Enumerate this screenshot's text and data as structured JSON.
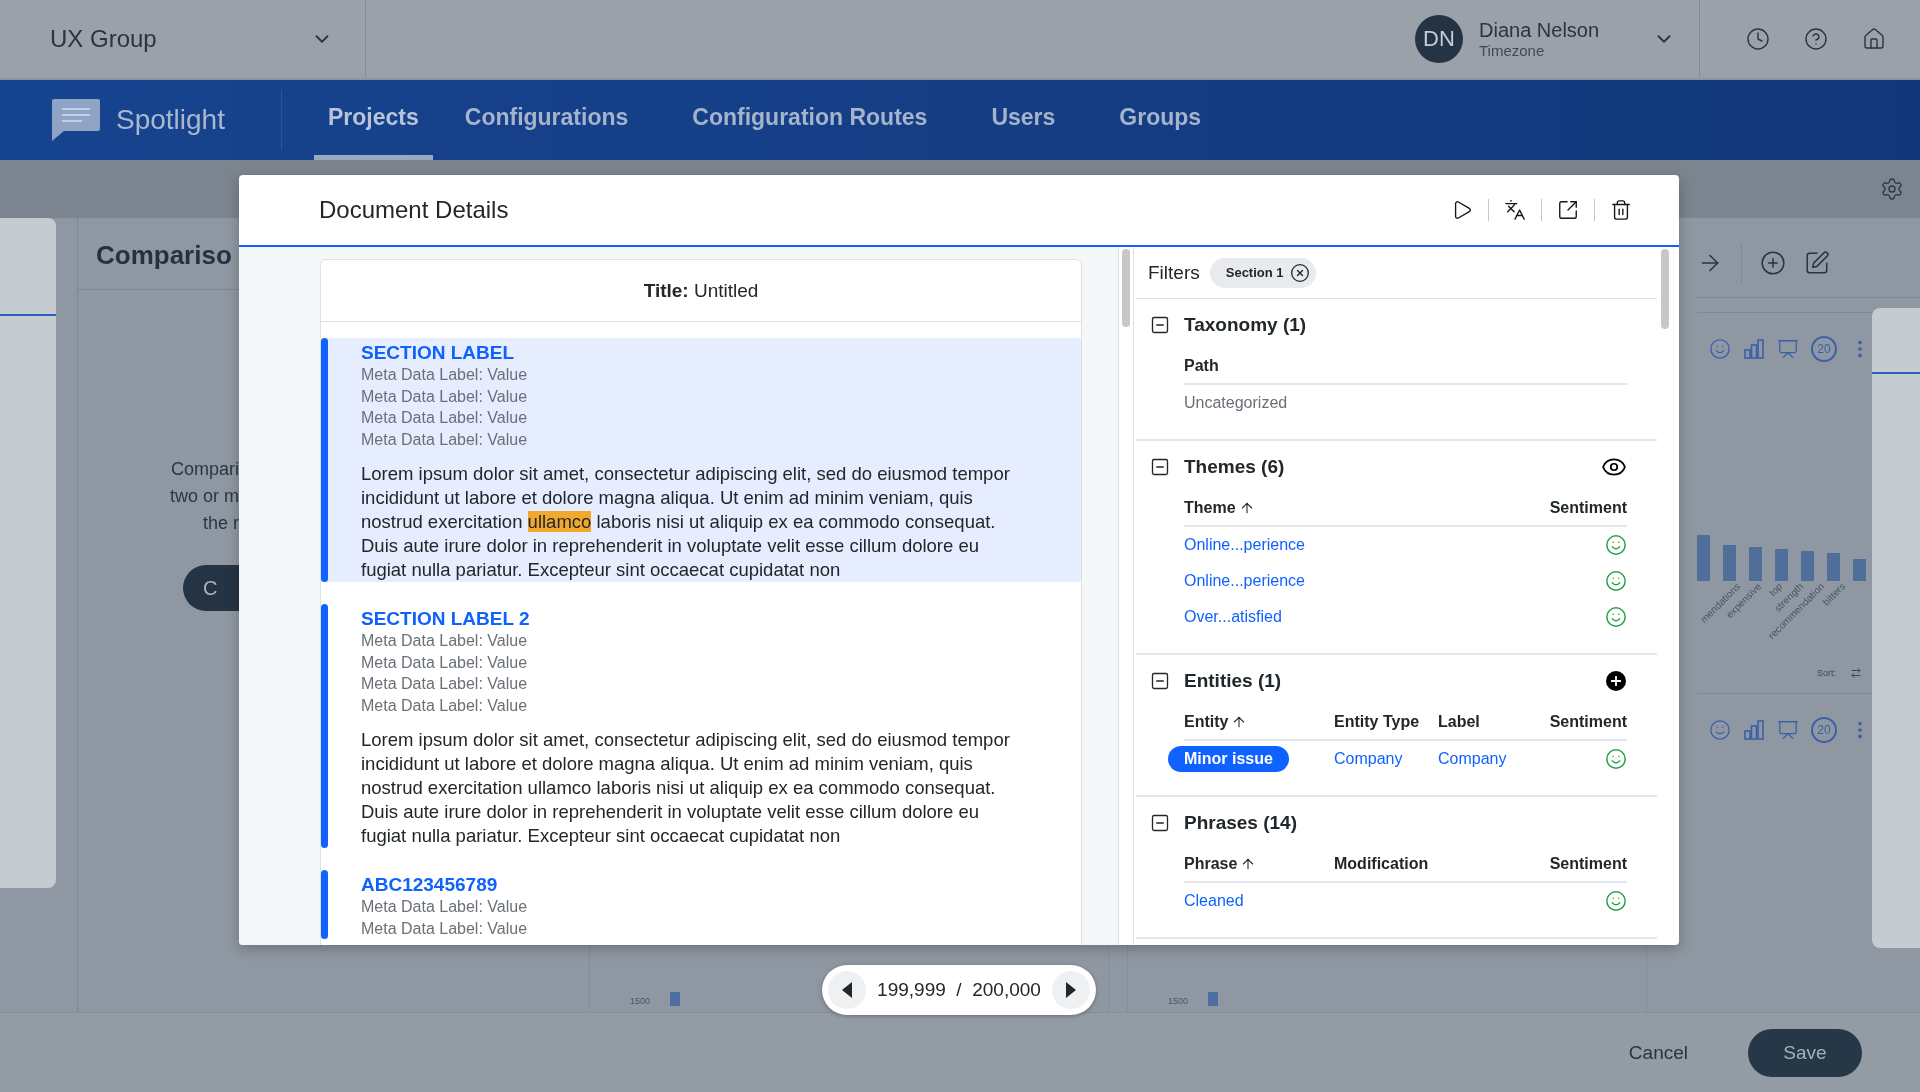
{
  "top_bar": {
    "group": "UX Group",
    "user": {
      "initials": "DN",
      "name": "Diana Nelson",
      "subtitle": "Timezone"
    }
  },
  "nav": {
    "brand": "Spotlight",
    "tabs": [
      {
        "label": "Projects",
        "selected": true
      },
      {
        "label": "Configurations",
        "selected": false
      },
      {
        "label": "Configuration Routes",
        "selected": false
      },
      {
        "label": "Users",
        "selected": false
      },
      {
        "label": "Groups",
        "selected": false
      }
    ]
  },
  "background": {
    "heading": "Compariso",
    "empty_lines": [
      "Compari",
      "two or m",
      "the r"
    ],
    "start_button": "C",
    "chart_labels": [
      "mendations",
      "expensive",
      "top",
      "strength",
      "recommendation",
      "bitters"
    ],
    "sort_label": "Sort:",
    "panels": [
      {
        "count": "20"
      },
      {
        "count": "20"
      }
    ],
    "lower_charts": [
      {
        "tick": "1500"
      },
      {
        "tick": "1500"
      }
    ]
  },
  "modal": {
    "title": "Document Details",
    "document": {
      "title": "**Title:** Untitled",
      "sections": [
        {
          "label": "SECTION LABEL",
          "selected": true,
          "meta": [
            "Meta Data Label: Value",
            "Meta Data Label: Value",
            "Meta Data Label: Value",
            "Meta Data Label: Value"
          ],
          "paragraph": [
            {
              "text": "Lorem ipsum dolor sit amet, consectetur adipiscing elit, sed do eiusmod tempor incididunt ut labore et dolore magna aliqua. Ut enim ad minim veniam, quis nostrud exercitation ",
              "highlighted": false
            },
            {
              "text": "ullamco",
              "highlighted": true
            },
            {
              "text": " laboris nisi ut aliquip ex ea commodo consequat. Duis aute irure dolor in reprehenderit in voluptate velit esse cillum dolore eu fugiat nulla pariatur. Excepteur sint occaecat cupidatat non",
              "highlighted": false
            }
          ]
        },
        {
          "label": "SECTION LABEL 2",
          "selected": false,
          "meta": [
            "Meta Data Label: Value",
            "Meta Data Label: Value",
            "Meta Data Label: Value",
            "Meta Data Label: Value"
          ],
          "paragraph": [
            {
              "text": "Lorem ipsum dolor sit amet, consectetur adipiscing elit, sed do eiusmod tempor incididunt ut labore et dolore magna aliqua. Ut enim ad minim veniam, quis nostrud exercitation ullamco laboris nisi ut aliquip ex ea commodo consequat. Duis aute irure dolor in reprehenderit in voluptate velit esse cillum dolore eu fugiat nulla pariatur. Excepteur sint occaecat cupidatat non",
              "highlighted": false
            }
          ]
        },
        {
          "label": "ABC123456789",
          "selected": false,
          "meta": [
            "Meta Data Label: Value",
            "Meta Data Label: Value"
          ]
        }
      ]
    },
    "filters": {
      "label": "Filters",
      "chips": [
        {
          "label": "Section 1"
        }
      ],
      "groups": [
        {
          "title": "Taxonomy (1)",
          "expanded": true,
          "columns": [
            {
              "label": "Path",
              "sorted": false
            }
          ],
          "rows": [
            {
              "cells": [
                {
                  "kind": "muted",
                  "text": "Uncategorized"
                }
              ]
            }
          ]
        },
        {
          "title": "Themes (6)",
          "expanded": true,
          "viewable": true,
          "columns": [
            {
              "label": "Theme",
              "sorted": true
            },
            {
              "label": "Sentiment",
              "sorted": false
            }
          ],
          "rows": [
            {
              "cells": [
                {
                  "kind": "link",
                  "text": "Online...perience"
                },
                {
                  "kind": "sentiment",
                  "positive": true
                }
              ]
            },
            {
              "cells": [
                {
                  "kind": "link",
                  "text": "Online...perience"
                },
                {
                  "kind": "sentiment",
                  "positive": true
                }
              ]
            },
            {
              "cells": [
                {
                  "kind": "link",
                  "text": "Over...atisfied"
                },
                {
                  "kind": "sentiment",
                  "positive": true
                }
              ]
            }
          ]
        },
        {
          "title": "Entities (1)",
          "expanded": true,
          "addable": true,
          "columns": [
            {
              "label": "Entity",
              "sorted": true
            },
            {
              "label": "Entity Type",
              "sorted": false
            },
            {
              "label": "Label",
              "sorted": false
            },
            {
              "label": "Sentiment",
              "sorted": false
            }
          ],
          "rows": [
            {
              "cells": [
                {
                  "kind": "pill",
                  "text": "Minor issue"
                },
                {
                  "kind": "link",
                  "text": "Company"
                },
                {
                  "kind": "link",
                  "text": "Company"
                },
                {
                  "kind": "sentiment",
                  "positive": true
                }
              ]
            }
          ]
        },
        {
          "title": "Phrases (14)",
          "expanded": true,
          "columns": [
            {
              "label": "Phrase",
              "sorted": true
            },
            {
              "label": "Modification",
              "sorted": false
            },
            {
              "label": "Sentiment",
              "sorted": false
            }
          ],
          "rows": [
            {
              "cells": [
                {
                  "kind": "link",
                  "text": "Cleaned"
                },
                {
                  "kind": "empty"
                },
                {
                  "kind": "sentiment",
                  "positive": true
                }
              ]
            }
          ]
        }
      ]
    }
  },
  "pager": {
    "current": "199,999",
    "separator": "/",
    "total": "200,000"
  },
  "footer": {
    "cancel": "Cancel",
    "save": "Save"
  }
}
